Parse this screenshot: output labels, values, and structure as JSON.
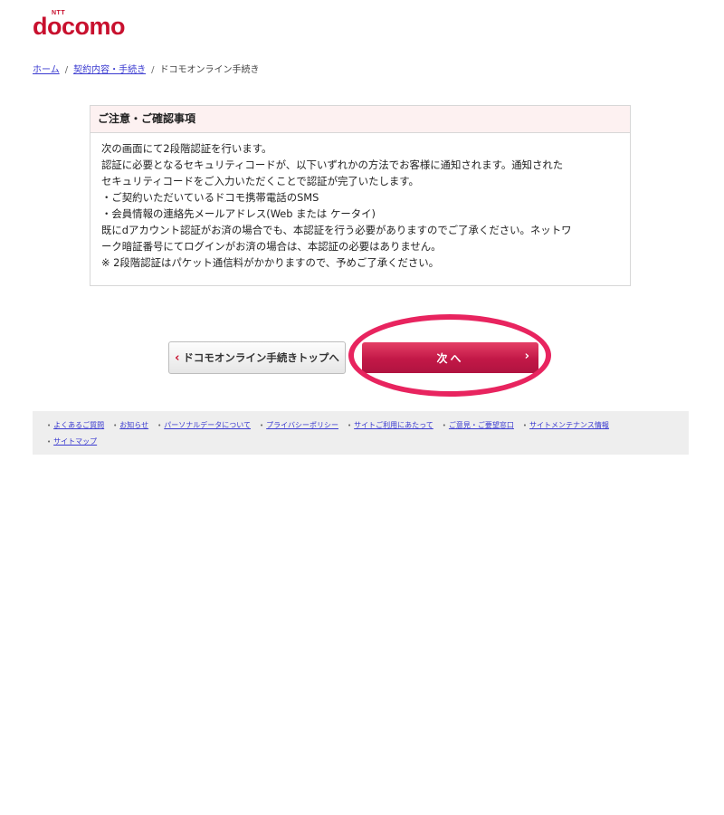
{
  "logo": {
    "small": "NTT",
    "word": "docomo"
  },
  "breadcrumb": {
    "home": "ホーム",
    "contract": "契約内容・手続き",
    "current": "ドコモオンライン手続き",
    "separator": "/"
  },
  "notice": {
    "title": "ご注意・ご確認事項",
    "lines": [
      "次の画面にて2段階認証を行います。",
      "認証に必要となるセキュリティコードが、以下いずれかの方法でお客様に通知されます。通知された",
      "セキュリティコードをご入力いただくことで認証が完了いたします。",
      "・ご契約いただいているドコモ携帯電話のSMS",
      "・会員情報の連絡先メールアドレス(Web または ケータイ)",
      "既にdアカウント認証がお済の場合でも、本認証を行う必要がありますのでご了承ください。ネットワ",
      "ーク暗証番号にてログインがお済の場合は、本認証の必要はありません。",
      "※ 2段階認証はパケット通信料がかかりますので、予めご了承ください。"
    ]
  },
  "buttons": {
    "back_chevron": "‹",
    "back_label": "ドコモオンライン手続きトップへ",
    "next_label": "次へ",
    "next_chevron": "›"
  },
  "footer": {
    "bullet": "•",
    "links_row1": [
      "よくあるご質問",
      "お知らせ",
      "パーソナルデータについて",
      "プライバシーポリシー",
      "サイトご利用にあたって",
      "ご意見・ご要望窓口",
      "サイトメンテナンス情報"
    ],
    "links_row2": [
      "サイトマップ"
    ]
  },
  "colors": {
    "brand": "#c8102e",
    "next_button": "#c21847",
    "highlight": "#e8245f",
    "link": "#3b3bd0"
  }
}
